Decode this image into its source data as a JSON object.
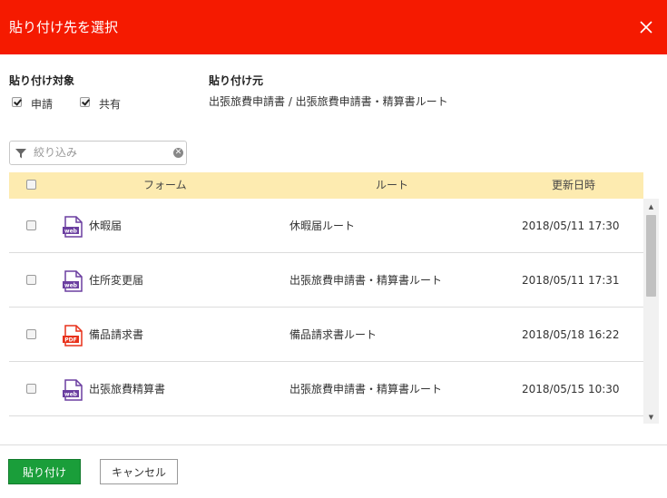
{
  "dialog": {
    "title": "貼り付け先を選択"
  },
  "target": {
    "label": "貼り付け対象",
    "options": [
      {
        "label": "申請",
        "checked": true
      },
      {
        "label": "共有",
        "checked": true
      }
    ]
  },
  "source": {
    "label": "貼り付け元",
    "value": "出張旅費申請書 / 出張旅費申請書・精算書ルート"
  },
  "filter": {
    "placeholder": "絞り込み"
  },
  "table": {
    "headers": {
      "form": "フォーム",
      "route": "ルート",
      "updated": "更新日時"
    },
    "rows": [
      {
        "name": "休暇届",
        "type": "web",
        "route": "休暇届ルート",
        "date": "2018/05/11 17:30"
      },
      {
        "name": "住所変更届",
        "type": "web",
        "route": "出張旅費申請書・精算書ルート",
        "date": "2018/05/11 17:31"
      },
      {
        "name": "備品請求書",
        "type": "PDF",
        "route": "備品請求書ルート",
        "date": "2018/05/18 16:22"
      },
      {
        "name": "出張旅費精算書",
        "type": "web",
        "route": "出張旅費申請書・精算書ルート",
        "date": "2018/05/15 10:30"
      }
    ]
  },
  "buttons": {
    "paste": "貼り付け",
    "cancel": "キャンセル"
  },
  "colors": {
    "header": "#f51a00",
    "table_header": "#fdebb0",
    "paste_button": "#1a9e3a",
    "web_icon": "#6b3fa0",
    "pdf_icon": "#e8311a"
  }
}
